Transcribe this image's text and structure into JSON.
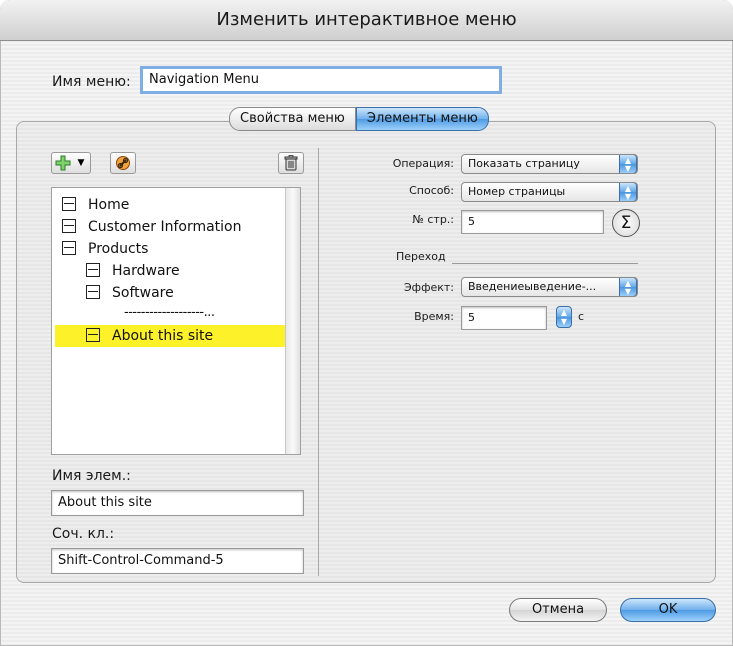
{
  "window": {
    "title": "Изменить интерактивное меню"
  },
  "menu_name": {
    "label": "Имя меню:",
    "value": "Navigation Menu"
  },
  "tabs": [
    {
      "label": "Свойства меню",
      "selected": false
    },
    {
      "label": "Элементы меню",
      "selected": true
    }
  ],
  "toolbar": {
    "add_icon": "plus-icon",
    "link_icon": "link-icon",
    "delete_icon": "trash-icon"
  },
  "tree": {
    "items": [
      {
        "label": "Home",
        "level": 0,
        "selected": false
      },
      {
        "label": "Customer Information",
        "level": 0,
        "selected": false
      },
      {
        "label": "Products",
        "level": 0,
        "selected": false
      },
      {
        "label": "Hardware",
        "level": 1,
        "selected": false
      },
      {
        "label": "Software",
        "level": 1,
        "selected": false
      },
      {
        "label": "-------------------...",
        "level": 1,
        "separator": true
      },
      {
        "label": "About this site",
        "level": 1,
        "selected": true
      }
    ]
  },
  "item_name": {
    "label": "Имя элем.:",
    "value": "About this site"
  },
  "shortcut": {
    "label": "Соч. кл.:",
    "value": "Shift-Control-Command-5"
  },
  "operation": {
    "label": "Операция:",
    "value": "Показать страницу"
  },
  "method": {
    "label": "Способ:",
    "value": "Номер страницы"
  },
  "page_number": {
    "label": "№ стр.:",
    "value": "5",
    "sigma": "Σ"
  },
  "transition": {
    "section_label": "Переход",
    "effect_label": "Эффект:",
    "effect_value": "Введениеыведение-...",
    "time_label": "Время:",
    "time_value": "5",
    "time_unit": "с"
  },
  "buttons": {
    "cancel": "Отмена",
    "ok": "OK"
  },
  "colors": {
    "selection": "#fdf22a",
    "accent": "#4f9be4"
  }
}
